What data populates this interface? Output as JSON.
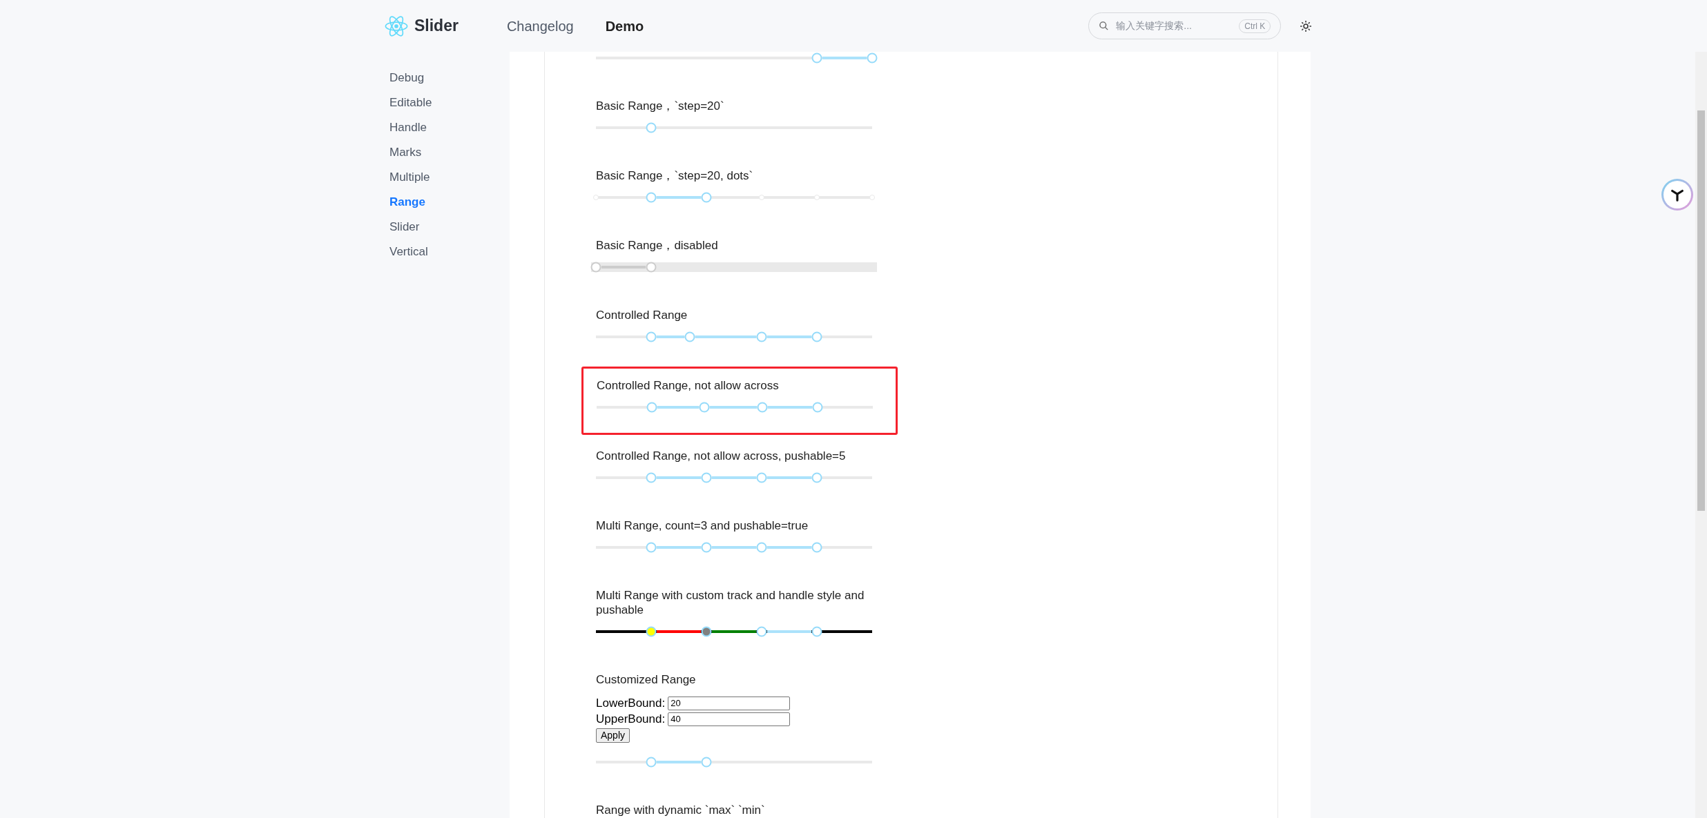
{
  "header": {
    "logo": "Slider",
    "nav": [
      {
        "label": "Changelog",
        "selected": false
      },
      {
        "label": "Demo",
        "selected": true
      }
    ],
    "search": {
      "placeholder": "输入关键字搜索...",
      "shortcut": "Ctrl K"
    }
  },
  "sidebar": {
    "items": [
      {
        "label": "Debug",
        "selected": false
      },
      {
        "label": "Editable",
        "selected": false
      },
      {
        "label": "Handle",
        "selected": false
      },
      {
        "label": "Marks",
        "selected": false
      },
      {
        "label": "Multiple",
        "selected": false
      },
      {
        "label": "Range",
        "selected": true
      },
      {
        "label": "Slider",
        "selected": false
      },
      {
        "label": "Vertical",
        "selected": false
      }
    ]
  },
  "sections": [
    {
      "slider": {
        "kind": "range",
        "handles": [
          {
            "level": 0.8
          },
          {
            "level": 1
          }
        ]
      }
    },
    {
      "label": "Basic Range，`step=20`",
      "slider": {
        "kind": "range",
        "handles": [
          {
            "level": 0.2
          }
        ]
      }
    },
    {
      "label": "Basic Range，`step=20, dots`",
      "slider": {
        "kind": "dots",
        "handles": [
          {
            "level": 0.2
          },
          {
            "level": 0.4
          }
        ],
        "dots": [
          {
            "level": 0
          },
          {
            "level": 0.6
          },
          {
            "level": 0.8
          },
          {
            "level": 1
          }
        ]
      }
    },
    {
      "label": "Basic Range，disabled",
      "slider": {
        "kind": "disabled",
        "handles": [
          {
            "level": 0
          },
          {
            "level": 0.2
          }
        ]
      }
    },
    {
      "label": "Controlled Range",
      "slider": {
        "kind": "range",
        "handles": [
          {
            "level": 0.2
          },
          {
            "level": 0.34
          },
          {
            "level": 0.6
          },
          {
            "level": 0.8
          }
        ]
      }
    },
    {
      "label": "Controlled Range, not allow across",
      "highlighted": true,
      "slider": {
        "kind": "range",
        "handles": [
          {
            "level": 0.2
          },
          {
            "level": 0.39
          },
          {
            "level": 0.6
          },
          {
            "level": 0.8
          }
        ]
      }
    },
    {
      "label": "Controlled Range, not allow across, pushable=5",
      "slider": {
        "kind": "range",
        "handles": [
          {
            "level": 0.2
          },
          {
            "level": 0.4
          },
          {
            "level": 0.6
          },
          {
            "level": 0.8
          }
        ]
      }
    },
    {
      "label": "Multi Range, count=3 and pushable=true",
      "slider": {
        "kind": "range",
        "handles": [
          {
            "level": 0.2
          },
          {
            "level": 0.4
          },
          {
            "level": 0.6
          },
          {
            "level": 0.8
          }
        ]
      }
    },
    {
      "label": "Multi Range with custom track and handle style and pushable",
      "slider": {
        "kind": "custom",
        "handles": [
          {
            "level": 0.2,
            "color": "#ffff00"
          },
          {
            "level": 0.4,
            "color": "#808080"
          },
          {
            "level": 0.6
          },
          {
            "level": 0.8
          }
        ],
        "tracks": [
          {
            "color": "#ff0000"
          },
          {
            "color": "#008000"
          },
          {
            "color": "#abe2fb"
          }
        ]
      }
    },
    {
      "label": "Customized Range",
      "form": {
        "fields": [
          {
            "label": "LowerBound:",
            "value": "20"
          },
          {
            "label": "UpperBound:",
            "value": "40"
          }
        ],
        "button": "Apply"
      },
      "slider": {
        "kind": "range",
        "handles": [
          {
            "level": 0.2
          },
          {
            "level": 0.4
          }
        ]
      }
    },
    {
      "label": "Range with dynamic `max` `min`"
    }
  ]
}
